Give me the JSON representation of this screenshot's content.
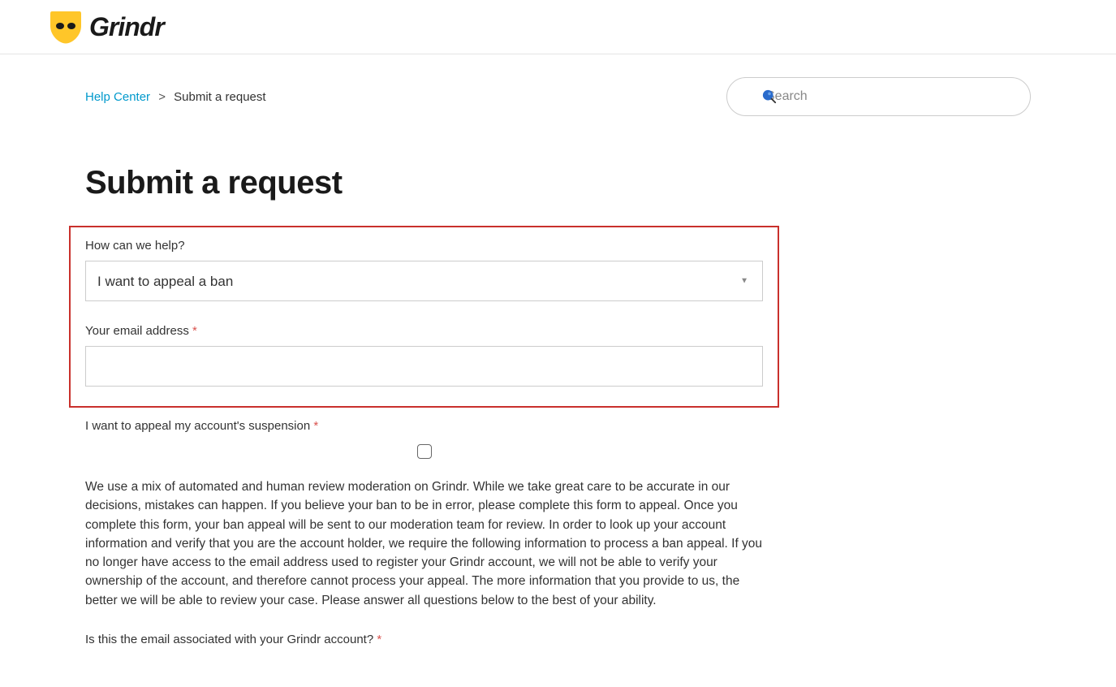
{
  "logo_text": "Grindr",
  "breadcrumb": {
    "home": "Help Center",
    "current": "Submit a request"
  },
  "search": {
    "placeholder": "Search"
  },
  "page": {
    "title": "Submit a request"
  },
  "form": {
    "help_label": "How can we help?",
    "help_value": "I want to appeal a ban",
    "email_label": "Your email address",
    "appeal_label": "I want to appeal my account's suspension",
    "description": "We use a mix of automated and human review moderation on Grindr. While we take great care to be accurate in our decisions, mistakes can happen. If you believe your ban to be in error, please complete this form to appeal. Once you complete this form, your ban appeal will be sent to our moderation team for review. In order to look up your account information and verify that you are the account holder, we require the following information to process a ban appeal. If you no longer have access to the email address used to register your Grindr account, we will not be able to verify your ownership of the account, and therefore cannot process your appeal. The more information that you provide to us, the better we will be able to review your case. Please answer all questions below to the best of your ability.",
    "email_assoc_label": "Is this the email associated with your Grindr account?"
  }
}
